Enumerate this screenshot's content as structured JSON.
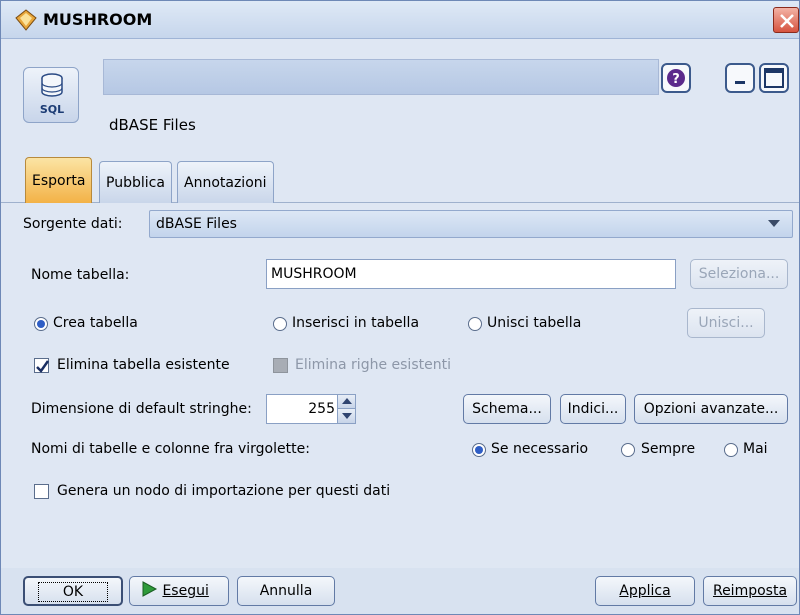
{
  "window": {
    "title": "MUSHROOM",
    "icon": "diamond-node-icon"
  },
  "header": {
    "node_icon_text": "SQL",
    "node_label": "dBASE Files",
    "help_icon": "help-icon",
    "minimize_icon": "minimize-icon",
    "maximize_icon": "maximize-icon"
  },
  "tabs": [
    {
      "label": "Esporta",
      "active": true
    },
    {
      "label": "Pubblica",
      "active": false
    },
    {
      "label": "Annotazioni",
      "active": false
    }
  ],
  "form": {
    "source_label": "Sorgente dati:",
    "source_value": "dBASE Files",
    "table_name_label": "Nome tabella:",
    "table_name_value": "MUSHROOM",
    "select_button": "Seleziona...",
    "mode_options": [
      {
        "label": "Crea tabella",
        "selected": true
      },
      {
        "label": "Inserisci in tabella",
        "selected": false
      },
      {
        "label": "Unisci tabella",
        "selected": false
      }
    ],
    "merge_button": "Unisci...",
    "drop_existing_label": "Elimina tabella esistente",
    "drop_existing_checked": true,
    "delete_rows_label": "Elimina righe esistenti",
    "delete_rows_checked": false,
    "string_size_label": "Dimensione di default stringhe:",
    "string_size_value": "255",
    "schema_button": "Schema...",
    "indexes_button": "Indici...",
    "advanced_button": "Opzioni avanzate...",
    "quote_label": "Nomi di tabelle e colonne fra virgolette:",
    "quote_options": [
      {
        "label": "Se necessario",
        "selected": true
      },
      {
        "label": "Sempre",
        "selected": false
      },
      {
        "label": "Mai",
        "selected": false
      }
    ],
    "import_node_label": "Genera un nodo di importazione per questi dati",
    "import_node_checked": false
  },
  "footer": {
    "ok": "OK",
    "run": "Esegui",
    "cancel": "Annulla",
    "apply": "Applica",
    "reset": "Reimposta"
  }
}
